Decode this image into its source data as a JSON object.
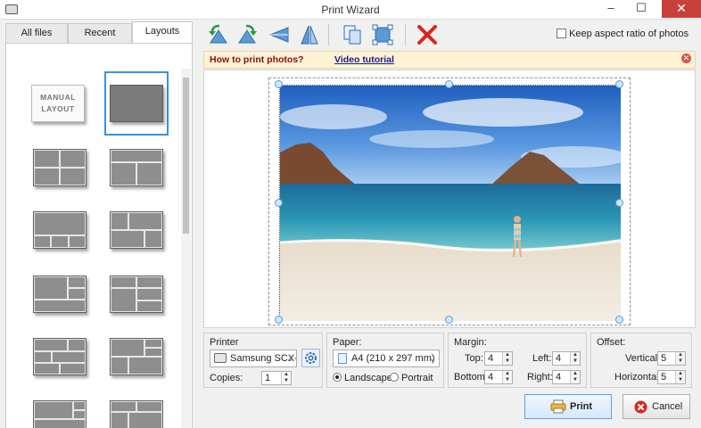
{
  "window": {
    "title": "Print Wizard",
    "minimize": "–",
    "maximize": "☐",
    "close": "✕"
  },
  "tabs": [
    {
      "label": "All files"
    },
    {
      "label": "Recent"
    },
    {
      "label": "Layouts"
    }
  ],
  "layouts": {
    "manual_label_line1": "MANUAL",
    "manual_label_line2": "LAYOUT"
  },
  "toolbar": {
    "icons": [
      "rotate-left-icon",
      "rotate-right-icon",
      "flip-horizontal-icon",
      "flip-vertical-icon",
      "copy-icon",
      "fit-frame-icon",
      "delete-icon"
    ],
    "keep_aspect_label": "Keep aspect ratio of photos"
  },
  "infobar": {
    "how_to": "How to print photos?",
    "video": "Video tutorial"
  },
  "printer": {
    "title": "Printer",
    "selected": "Samsung SCX-",
    "copies_label": "Copies:",
    "copies": "1"
  },
  "paper": {
    "title": "Paper:",
    "selected": "A4 (210 x 297 mm)",
    "landscape": "Landscape",
    "portrait": "Portrait"
  },
  "margin": {
    "title": "Margin:",
    "top_label": "Top:",
    "top": "4",
    "bottom_label": "Bottom:",
    "bottom": "4",
    "left_label": "Left:",
    "left": "4",
    "right_label": "Right:",
    "right": "4"
  },
  "offset": {
    "title": "Offset:",
    "vertical_label": "Vertical:",
    "vertical": "5",
    "horizontal_label": "Horizontal:",
    "horizontal": "5"
  },
  "buttons": {
    "print": "Print",
    "cancel": "Cancel"
  },
  "colors": {
    "accent": "#3a8fe0",
    "info_text": "#8a0d0d",
    "close_red": "#c7413a"
  }
}
